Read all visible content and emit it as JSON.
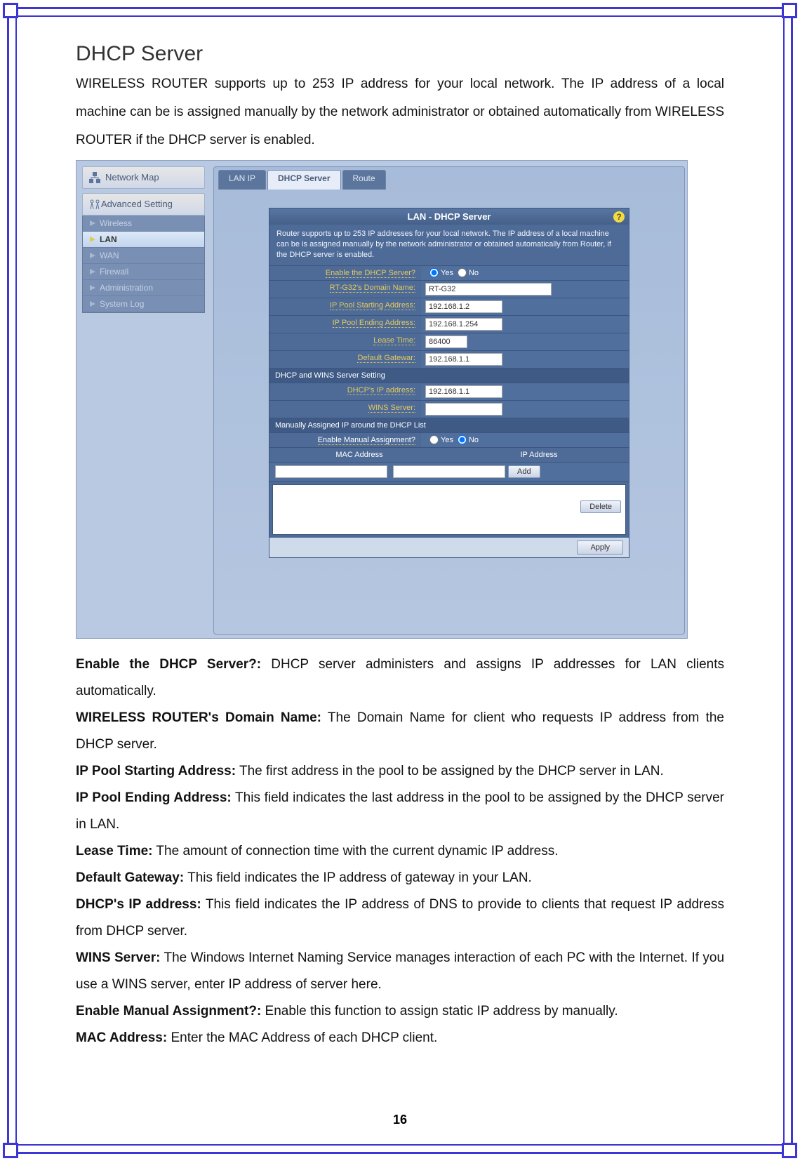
{
  "doc": {
    "title": "DHCP Server",
    "intro": "WIRELESS ROUTER supports up to 253 IP address for your local network. The IP address of a local machine can be is assigned manually by the network administrator or obtained automatically from WIRELESS ROUTER if the DHCP server is enabled.",
    "page_number": "16"
  },
  "sidebar": {
    "network_map": "Network Map",
    "advanced": "Advanced Setting",
    "items": [
      {
        "label": "Wireless"
      },
      {
        "label": "LAN"
      },
      {
        "label": "WAN"
      },
      {
        "label": "Firewall"
      },
      {
        "label": "Administration"
      },
      {
        "label": "System Log"
      }
    ]
  },
  "tabs": {
    "lanip": "LAN IP",
    "dhcp": "DHCP Server",
    "route": "Route"
  },
  "panel": {
    "title": "LAN - DHCP Server",
    "help": "?",
    "desc": "Router  supports up to 253 IP addresses for your local network. The IP address of a local machine can be is assigned manually by the network administrator or obtained automatically from Router,  if the DHCP server is enabled.",
    "fields": {
      "enable": "Enable the DHCP Server?",
      "yes": "Yes",
      "no": "No",
      "domain": "RT-G32's Domain Name:",
      "domain_val": "RT-G32",
      "start": "IP Pool Starting Address:",
      "start_val": "192.168.1.2",
      "end": "IP Pool Ending Address:",
      "end_val": "192.168.1.254",
      "lease": "Lease Time:",
      "lease_val": "86400",
      "gw": "Default Gatewar:",
      "gw_val": "192.168.1.1"
    },
    "sec2": "DHCP and WINS Server Setting",
    "fields2": {
      "dhcpip": "DHCP's IP address:",
      "dhcpip_val": "192.168.1.1",
      "wins": "WINS Server:"
    },
    "sec3": "Manually Assigned IP around the DHCP List",
    "manual": {
      "enable": "Enable Manual Assignment?",
      "mac": "MAC Address",
      "ip": "IP Address",
      "add": "Add",
      "delete": "Delete",
      "apply": "Apply"
    }
  },
  "defs": [
    {
      "t": "Enable the DHCP Server?:",
      "d": " DHCP server administers and assigns IP addresses for LAN clients automatically."
    },
    {
      "t": "WIRELESS ROUTER's Domain Name:",
      "d": " The Domain Name for client who requests IP address from the DHCP server."
    },
    {
      "t": "IP Pool Starting Address:",
      "d": " The first address in the pool to be assigned by the DHCP server in LAN."
    },
    {
      "t": "IP Pool Ending Address:",
      "d": " This field indicates the last address in the pool to be assigned by the DHCP server in LAN."
    },
    {
      "t": "Lease Time:",
      "d": " The amount of connection time with the current dynamic IP address."
    },
    {
      "t": "Default Gateway:",
      "d": " This field indicates the IP address of gateway in your LAN."
    },
    {
      "t": "DHCP's IP address:",
      "d": " This field indicates the IP address of DNS to provide to clients that request IP address from DHCP server."
    },
    {
      "t": "WINS Server:",
      "d": " The Windows Internet Naming Service manages interaction of each PC with the Internet. If you use a WINS server, enter IP address of server here."
    },
    {
      "t": "Enable Manual Assignment?:",
      "d": " Enable this function to assign static IP address by manually."
    },
    {
      "t": "MAC Address:",
      "d": " Enter the MAC Address of each DHCP client."
    }
  ]
}
